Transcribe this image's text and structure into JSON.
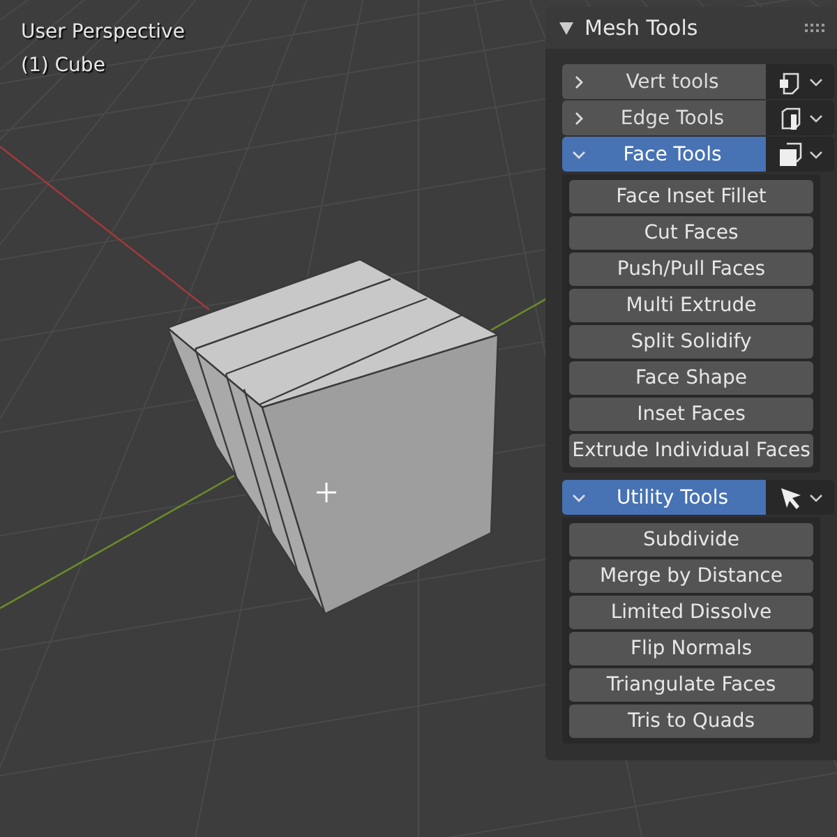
{
  "viewport": {
    "view_name": "User Perspective",
    "object_name": "(1) Cube"
  },
  "panel": {
    "title": "Mesh Tools",
    "sections": [
      {
        "label": "Vert tools",
        "expanded": false,
        "kind": "vert"
      },
      {
        "label": "Edge Tools",
        "expanded": false,
        "kind": "edge"
      },
      {
        "label": "Face Tools",
        "expanded": true,
        "kind": "face",
        "buttons": [
          "Face Inset Fillet",
          "Cut Faces",
          "Push/Pull Faces",
          "Multi Extrude",
          "Split Solidify",
          "Face Shape",
          "Inset Faces",
          "Extrude Individual Faces"
        ]
      },
      {
        "label": "Utility Tools",
        "expanded": true,
        "kind": "select",
        "buttons": [
          "Subdivide",
          "Merge by Distance",
          "Limited Dissolve",
          "Flip Normals",
          "Triangulate Faces",
          "Tris to Quads"
        ]
      }
    ]
  }
}
